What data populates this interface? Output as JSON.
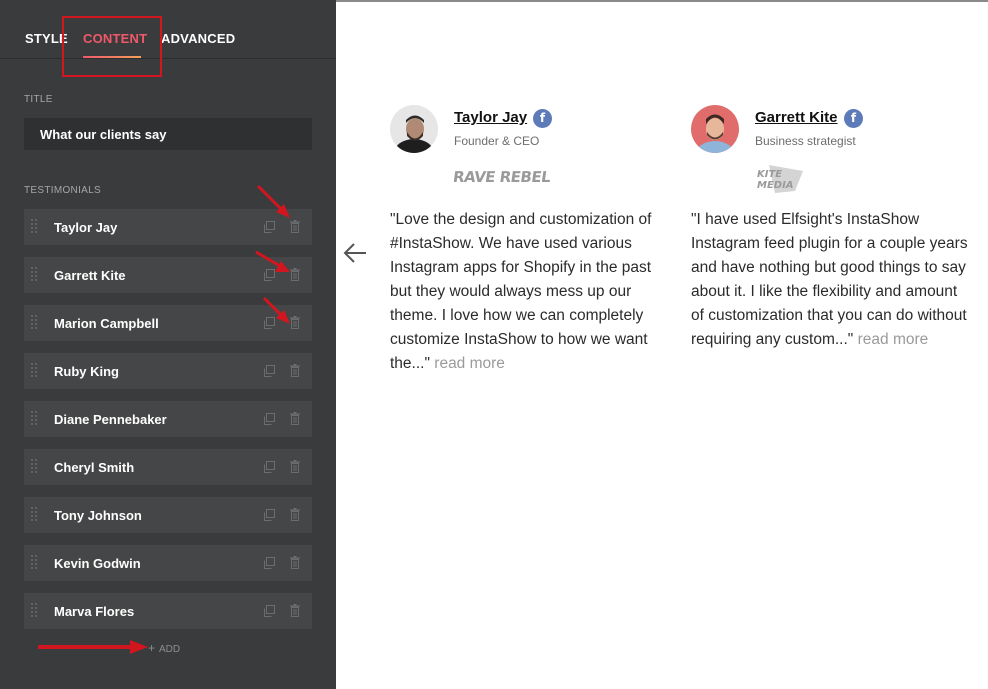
{
  "tabs": {
    "style": "STYLE",
    "content": "CONTENT",
    "advanced": "ADVANCED"
  },
  "title_section": {
    "label": "TITLE",
    "value": "What our clients say"
  },
  "testimonials_section": {
    "label": "TESTIMONIALS",
    "items": [
      {
        "name": "Taylor Jay"
      },
      {
        "name": "Garrett Kite"
      },
      {
        "name": "Marion Campbell"
      },
      {
        "name": "Ruby King"
      },
      {
        "name": "Diane Pennebaker"
      },
      {
        "name": "Cheryl Smith"
      },
      {
        "name": "Tony Johnson"
      },
      {
        "name": "Kevin Godwin"
      },
      {
        "name": "Marva Flores"
      }
    ],
    "add_label": "ADD"
  },
  "preview": {
    "cards": [
      {
        "name": "Taylor Jay",
        "role": "Founder & CEO",
        "company_logo": "RAVE REBEL",
        "social_icon": "facebook-icon",
        "quote": "\"Love the design and customization of #InstaShow. We have used various Instagram apps for Shopify in the past but they would always mess up our theme. I love how we can completely customize InstaShow to how we want the...\"",
        "read_more": "read more"
      },
      {
        "name": "Garrett Kite",
        "role": "Business strategist",
        "company_logo_line1": "KITE",
        "company_logo_line2": "MEDIA",
        "social_icon": "facebook-icon",
        "quote": "\"I have used Elfsight's InstaShow Instagram feed plugin for a couple years and have nothing but good things to say about it. I like the flexibility and amount of customization that you can do without requiring any custom...\"",
        "read_more": "read more"
      }
    ]
  },
  "colors": {
    "sidebar_bg": "#3a3b3c",
    "item_bg": "#454647",
    "accent_tab": "#f0596a",
    "annotation_red": "#d1161f",
    "facebook_blue": "#5d7bb9"
  }
}
